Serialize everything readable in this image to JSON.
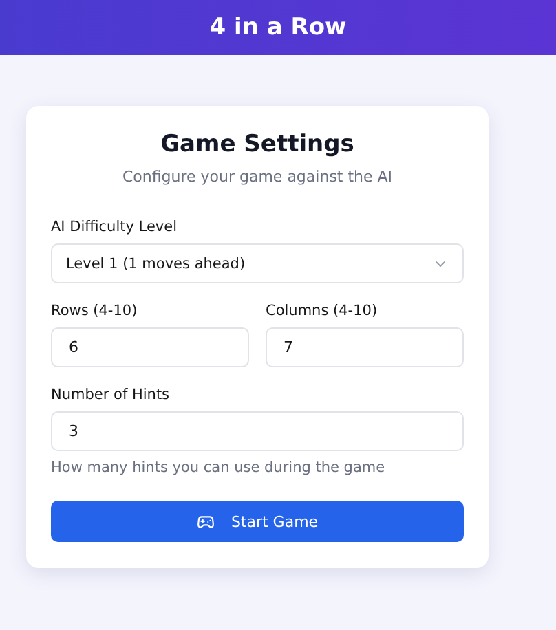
{
  "header": {
    "title": "4 in a Row"
  },
  "settings": {
    "title": "Game Settings",
    "subtitle": "Configure your game against the AI",
    "difficulty": {
      "label": "AI Difficulty Level",
      "value": "Level 1 (1 moves ahead)"
    },
    "rows": {
      "label": "Rows (4-10)",
      "value": "6"
    },
    "columns": {
      "label": "Columns (4-10)",
      "value": "7"
    },
    "hints": {
      "label": "Number of Hints",
      "value": "3",
      "help": "How many hints you can use during the game"
    },
    "start_button": "Start Game"
  }
}
